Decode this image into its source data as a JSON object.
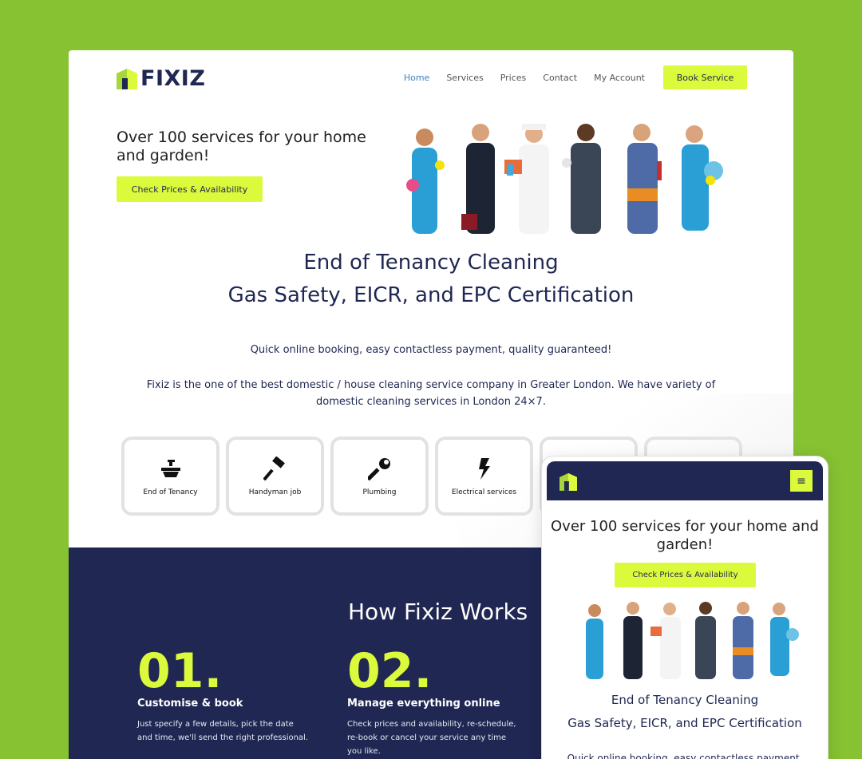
{
  "colors": {
    "background": "#86c232",
    "navy": "#1f2752",
    "lime": "#dcfa3c",
    "active_link": "#3b82c4"
  },
  "brand": {
    "name": "FIXIZ",
    "logo_icon": "house-door-icon"
  },
  "nav": {
    "items": [
      "Home",
      "Services",
      "Prices",
      "Contact",
      "My Account"
    ],
    "active": "Home",
    "book_label": "Book Service"
  },
  "hero": {
    "headline": "Over 100 services for your home and garden!",
    "cta_label": "Check Prices & Availability",
    "image": "team-of-six-workers-photo"
  },
  "headings": {
    "line1": "End of Tenancy Cleaning",
    "line2": "Gas Safety, EICR, and EPC Certification"
  },
  "tagline": "Quick online booking, easy contactless payment, quality guaranteed!",
  "description": "Fixiz is the one of the best domestic / house cleaning service company in Greater London. We have variety of domestic cleaning services in London 24×7.",
  "services": [
    {
      "label": "End of Tenancy",
      "icon": "sink-icon"
    },
    {
      "label": "Handyman job",
      "icon": "hammer-icon"
    },
    {
      "label": "Plumbing",
      "icon": "wrench-icon"
    },
    {
      "label": "Electrical services",
      "icon": "lightning-icon"
    },
    {
      "label": "",
      "icon": ""
    },
    {
      "label": "",
      "icon": ""
    }
  ],
  "how_it_works": {
    "title": "How Fixiz Works",
    "steps": [
      {
        "num": "01.",
        "title": "Customise & book",
        "text": "Just specify a few details, pick the date and time, we'll send the right professional."
      },
      {
        "num": "02.",
        "title": "Manage everything online",
        "text": "Check prices and availability, re-schedule, re-book or cancel your service any time you like."
      }
    ]
  },
  "mobile": {
    "menu_icon": "hamburger-icon",
    "headline": "Over 100 services for your home and garden!",
    "cta_label": "Check Prices & Availability",
    "line1": "End of Tenancy Cleaning",
    "line2": "Gas Safety, EICR, and EPC Certification",
    "tagline": "Quick online booking, easy contactless payment,"
  }
}
